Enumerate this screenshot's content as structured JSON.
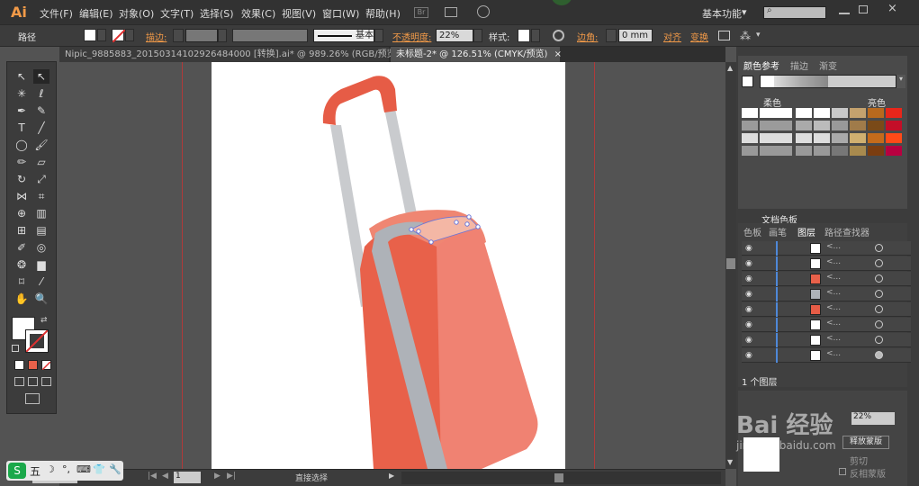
{
  "app": {
    "logo": "Ai"
  },
  "menu": [
    "文件(F)",
    "编辑(E)",
    "对象(O)",
    "文字(T)",
    "选择(S)",
    "效果(C)",
    "视图(V)",
    "窗口(W)",
    "帮助(H)"
  ],
  "topright": {
    "workspace": "基本功能",
    "workspace_arrow": "▾",
    "br_badge": "Br"
  },
  "control": {
    "selection_label": "路径",
    "stroke_label": "描边:",
    "stroke_style": "基本",
    "opacity_label": "不透明度:",
    "opacity_value": "22%",
    "style_label": "样式:",
    "corner_label": "边角:",
    "corner_value": "0 mm",
    "align_label": "对齐",
    "transform_label": "变换"
  },
  "tabs": [
    {
      "label": "Nipic_9885883_20150314102926484000 [转换].ai* @ 989.26% (RGB/预览)",
      "close": "×"
    },
    {
      "label": "未标题-2* @ 126.51% (CMYK/预览)",
      "close": "×"
    }
  ],
  "status": {
    "zoom": "126.51",
    "page": "1",
    "tool": "直接选择"
  },
  "color_panel": {
    "tabs": [
      "颜色参考",
      "描边",
      "渐变"
    ],
    "soft": "柔色",
    "bright": "亮色",
    "library": "文档色板"
  },
  "layers_panel": {
    "tabs": [
      "色板",
      "画笔",
      "图层",
      "路径查找器"
    ],
    "count": "1 个图层",
    "row_label": "<..."
  },
  "transparency_panel": {
    "mask_btn": "释放蒙版",
    "clip": "剪切",
    "invert": "反相蒙版",
    "pct": "22%"
  },
  "watermark": {
    "text": "Bai 经验",
    "url": "jingyan.baidu.com"
  },
  "taskbar": {
    "items": [
      "五",
      "☽",
      "°,",
      "⌨",
      "👕",
      "🔧"
    ]
  }
}
